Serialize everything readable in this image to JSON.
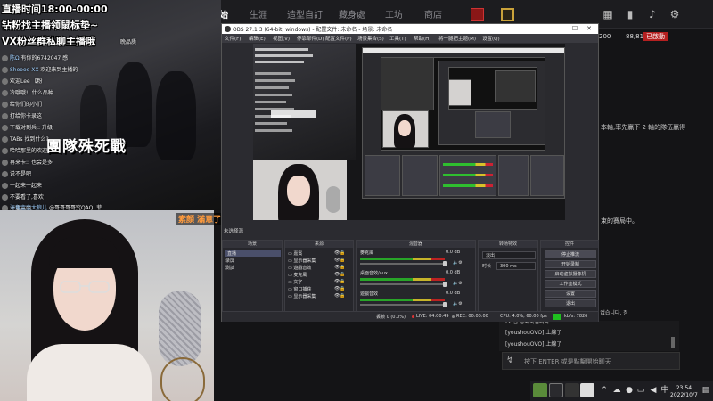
{
  "game": {
    "tabs": [
      "開始",
      "生涯",
      "造型自訂",
      "藏身處",
      "工坊",
      "商店"
    ],
    "stats": {
      "coins": "200",
      "points": "88,812",
      "badge": "已啟動"
    },
    "side_text_1": "本輪,率先贏下 2 輪的隊伍贏得",
    "side_text_2": "束的賽局中。",
    "chat_lines": [
      "에 지정을 수 없습니다. 정",
      "[youshouOVO] 上線了",
      "[youshouOVO] 上線了"
    ],
    "chat_placeholder": "按下 ENTER 或是點擊開始聊天",
    "chat_partial_left": "12 번 경쇄국입니다."
  },
  "taskbar": {
    "time": "23:54",
    "date": "2022/10/7"
  },
  "overlay": {
    "title_1": "直播时间18:00-00:00",
    "title_2": "钻粉找主播领鼠标垫~",
    "title_3": "VX粉丝群私聊主播哦",
    "corner_text": "晚品质",
    "tdm": "團隊殊死戰",
    "chat": [
      {
        "user": "陈Ω",
        "text": "有你的6742047 感"
      },
      {
        "user": "Shoooo XX",
        "text": "欢迎来到主播的"
      },
      {
        "user": "",
        "text": "欢迎Lee 【粉"
      },
      {
        "user": "",
        "text": "冷哦哦!! 什么品种"
      },
      {
        "user": "",
        "text": "给你们的小们"
      },
      {
        "user": "",
        "text": "打给你卡录这"
      },
      {
        "user": "",
        "text": "下载对到兵:: 升级"
      },
      {
        "user": "",
        "text": "TABs 找到什么?"
      },
      {
        "user": "",
        "text": "哈哈那里的欢迎"
      },
      {
        "user": "",
        "text": "再来卡:: 也会是多"
      },
      {
        "user": "",
        "text": "说不是吧"
      },
      {
        "user": "",
        "text": "一起来一起来"
      },
      {
        "user": "",
        "text": "不要看了,喜欢"
      },
      {
        "user": "",
        "text": "主要来吧"
      },
      {
        "user": "",
        "text": "看下飞机"
      },
      {
        "user": "海角宝宝大狼儿",
        "text": "@哥哥哥哥究QAQ: 菲"
      }
    ],
    "cam_tag": "素顏 滿意了吧"
  },
  "obs": {
    "title": "OBS 27.1.3 (64-bit, windows) - 配置文件: 未命名 - 场景: 未命名",
    "menu": [
      "文件(F)",
      "编辑(E)",
      "视图(V)",
      "停靠部件(D)",
      "配置文件(P)",
      "场景集合(S)",
      "工具(T)",
      "帮助(H)",
      "将一腿把主题(M)",
      "设置(Q)"
    ],
    "preview_label": "未选择源",
    "docks": {
      "scenes": {
        "title": "场景",
        "items": [
          "直播",
          "录屏",
          "測試"
        ]
      },
      "sources": {
        "title": "来源",
        "items": [
          "嘉賓",
          "显示器采集",
          "遊戲音效",
          "麦克風",
          "文字",
          "窗口捕获",
          "显示器采集"
        ]
      },
      "mixer": {
        "title": "混音器",
        "channels": [
          {
            "name": "麥克風",
            "level": "0.0 dB"
          },
          {
            "name": "桌面音效/aux",
            "level": "0.0 dB"
          },
          {
            "name": "遊戲音效",
            "level": "0.0 dB"
          }
        ]
      },
      "transitions": {
        "title": "转场特效",
        "effect": "淡出",
        "duration_label": "时长",
        "duration": "300 ms"
      },
      "controls": {
        "title": "控件",
        "buttons": [
          "停止推流",
          "开始录制",
          "启动虚拟摄像机",
          "工作室模式",
          "设置",
          "退出"
        ]
      }
    },
    "status": {
      "dropped": "丢帧 0 (0.0%)",
      "live": "LIVE: 04:00:49",
      "rec": "REC: 00:00:00",
      "cpu": "CPU: 4.0%, 60.00 fps",
      "kbps": "kb/s: 7826"
    }
  }
}
